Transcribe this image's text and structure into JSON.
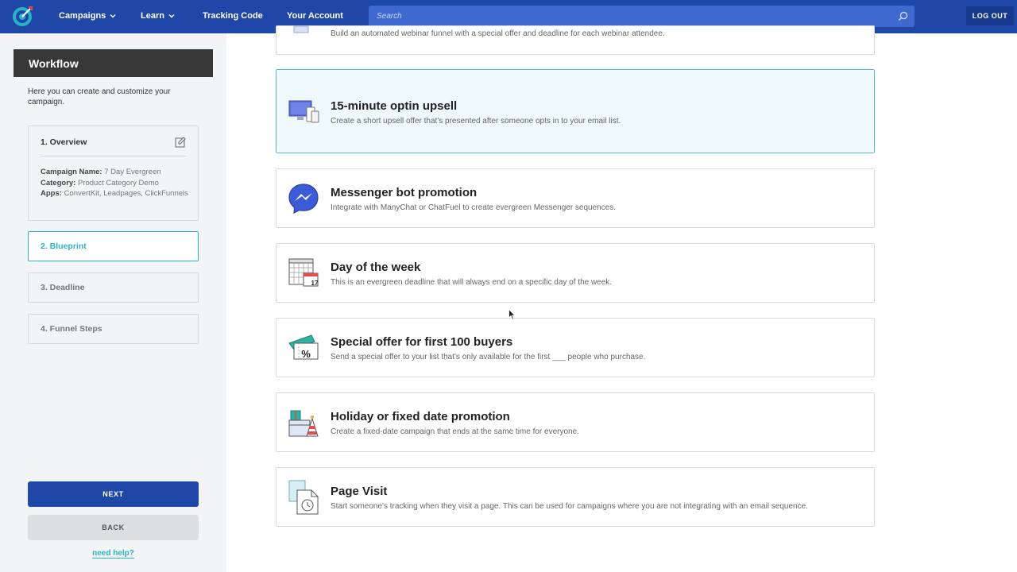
{
  "nav": {
    "items": [
      {
        "label": "Campaigns",
        "dropdown": true
      },
      {
        "label": "Learn",
        "dropdown": true
      },
      {
        "label": "Tracking Code",
        "dropdown": false
      },
      {
        "label": "Your Account",
        "dropdown": false
      }
    ],
    "search_placeholder": "Search",
    "logout_label": "LOG OUT"
  },
  "sidebar": {
    "title": "Workflow",
    "intro": "Here you can create and customize your campaign.",
    "steps": [
      {
        "label": "1. Overview"
      },
      {
        "label": "2. Blueprint",
        "active": true
      },
      {
        "label": "3. Deadline"
      },
      {
        "label": "4. Funnel Steps"
      }
    ],
    "overview": {
      "campaign_name_label": "Campaign Name:",
      "campaign_name": "7 Day Evergreen",
      "category_label": "Category:",
      "category": "Product Category Demo",
      "apps_label": "Apps:",
      "apps": "ConvertKit, Leadpages, ClickFunnels"
    },
    "next_label": "NEXT",
    "back_label": "BACK",
    "help_label": "need help?"
  },
  "blueprints": [
    {
      "title": "",
      "desc": "Build an automated webinar funnel with a special offer and deadline for each webinar attendee.",
      "icon": "webinar-icon"
    },
    {
      "title": "15-minute optin upsell",
      "desc": "Create a short upsell offer that's presented after someone opts in to your email list.",
      "icon": "devices-icon",
      "selected": true
    },
    {
      "title": "Messenger bot promotion",
      "desc": "Integrate with ManyChat or ChatFuel to create evergreen Messenger sequences.",
      "icon": "messenger-icon"
    },
    {
      "title": "Day of the week",
      "desc": "This is an evergreen deadline that will always end on a specific day of the week.",
      "icon": "calendar-icon",
      "calendar_day": "17"
    },
    {
      "title": "Special offer for first 100 buyers",
      "desc": "Send a special offer to your list that's only available for the first ___ people who purchase.",
      "icon": "ticket-icon",
      "ticket_symbol": "%"
    },
    {
      "title": "Holiday or fixed date promotion",
      "desc": "Create a fixed-date campaign that ends at the same time for everyone.",
      "icon": "party-gift-icon"
    },
    {
      "title": "Page Visit",
      "desc": "Start someone's tracking when they visit a page. This can be used for campaigns where you are not integrating with an email sequence.",
      "icon": "page-clock-icon"
    }
  ],
  "colors": {
    "brand": "#1f47a8",
    "accent": "#2bb3c3",
    "selected_bg": "#eff8fb"
  }
}
